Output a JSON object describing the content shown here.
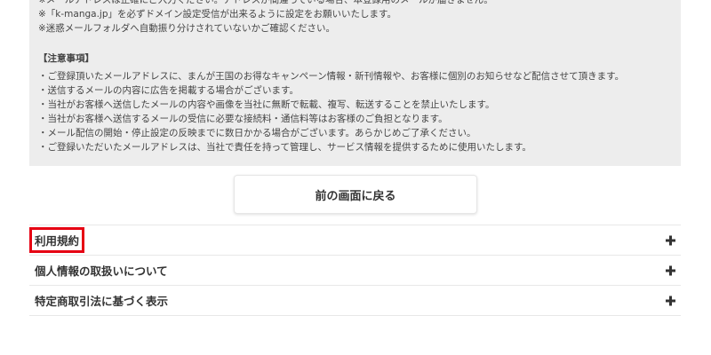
{
  "notice": {
    "top_lines": [
      "※メールアドレスは正確にご入力ください。アドレスが間違っている場合、本登録用のメールが届きません。",
      "※「k-manga.jp」を必ずドメイン設定受信が出来るように設定をお願いいたします。",
      "※迷惑メールフォルダへ自動振り分けされていないかご確認ください。"
    ],
    "heading": "【注意事項】",
    "bullets": [
      "・ご登録頂いたメールアドレスに、まんが王国のお得なキャンペーン情報・新刊情報や、お客様に個別のお知らせなど配信させて頂きます。",
      "・送信するメールの内容に広告を掲載する場合がございます。",
      "・当社がお客様へ送信したメールの内容や画像を当社に無断で転載、複写、転送することを禁止いたします。",
      "・当社がお客様へ送信するメールの受信に必要な接続料・通信料等はお客様のご負担となります。",
      "・メール配信の開始・停止設定の反映までに数日かかる場合がございます。あらかじめご了承ください。",
      "・ご登録いただいたメールアドレスは、当社で責任を持って管理し、サービス情報を提供するために使用いたします。"
    ]
  },
  "back_button": {
    "label": "前の画面に戻る"
  },
  "accordion": {
    "items": [
      {
        "label": "利用規約"
      },
      {
        "label": "個人情報の取扱いについて"
      },
      {
        "label": "特定商取引法に基づく表示"
      }
    ]
  },
  "colors": {
    "notice_bg": "#ededed",
    "highlight_border": "#e60012",
    "text": "#333333"
  }
}
